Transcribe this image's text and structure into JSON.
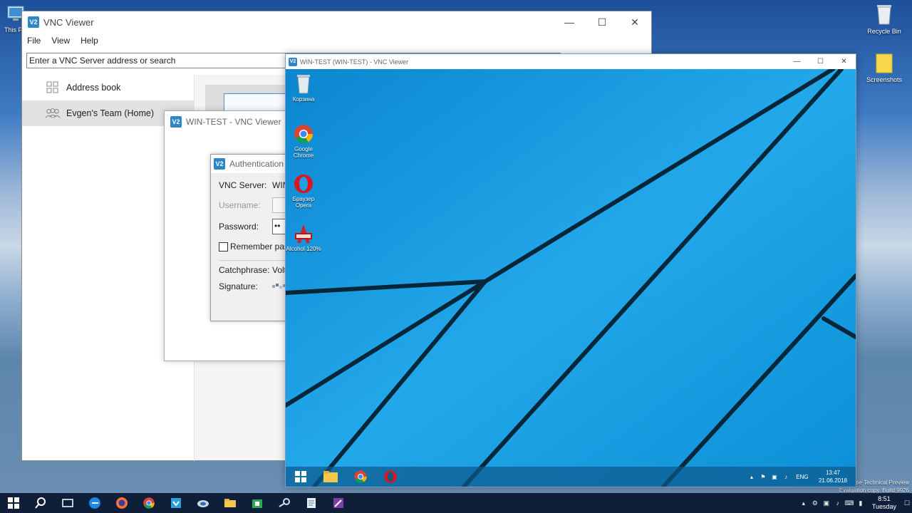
{
  "host_desktop": {
    "icons": [
      {
        "label": "This PC",
        "icon": "computer-icon"
      },
      {
        "label": "Recycle Bin",
        "icon": "recycle-bin-icon"
      },
      {
        "label": "Screenshots",
        "icon": "folder-icon"
      }
    ],
    "watermark_line1": "se Technical Preview",
    "watermark_line2": "Evaluation copy. Build 9926"
  },
  "vnc_main": {
    "title": "VNC Viewer",
    "menu": [
      "File",
      "View",
      "Help"
    ],
    "search_placeholder": "Enter a VNC Server address or search",
    "sidebar": [
      {
        "label": "Address book",
        "icon": "grid-icon"
      },
      {
        "label": "Evgen's Team (Home)",
        "icon": "team-icon"
      }
    ]
  },
  "vnc_connecting": {
    "title": "WIN-TEST - VNC Viewer"
  },
  "auth_dialog": {
    "title": "Authentication",
    "vnc_server_label": "VNC Server:",
    "vnc_server_value": "WIN",
    "username_label": "Username:",
    "password_label": "Password:",
    "password_value": "••",
    "remember_label": "Remember pas",
    "catchphrase_label": "Catchphrase:",
    "catchphrase_value": "Volt",
    "signature_label": "Signature:"
  },
  "remote_window": {
    "title": "WIN-TEST (WIN-TEST) - VNC Viewer",
    "desktop_icons": [
      {
        "label": "Корзина",
        "icon": "recycle-bin-icon"
      },
      {
        "label": "Google Chrome",
        "icon": "chrome-icon"
      },
      {
        "label": "Браузер Opera",
        "icon": "opera-icon"
      },
      {
        "label": "Alcohol 120%",
        "icon": "alcohol-icon"
      }
    ],
    "taskbar": {
      "lang": "ENG",
      "time": "13:47",
      "date": "21.06.2018"
    }
  },
  "host_taskbar": {
    "time": "8:51",
    "day": "Tuesday"
  },
  "colors": {
    "vnc_accent": "#2d86c6",
    "remote_desktop": "#1ea0e2",
    "taskbar": "#0f1f3a"
  }
}
